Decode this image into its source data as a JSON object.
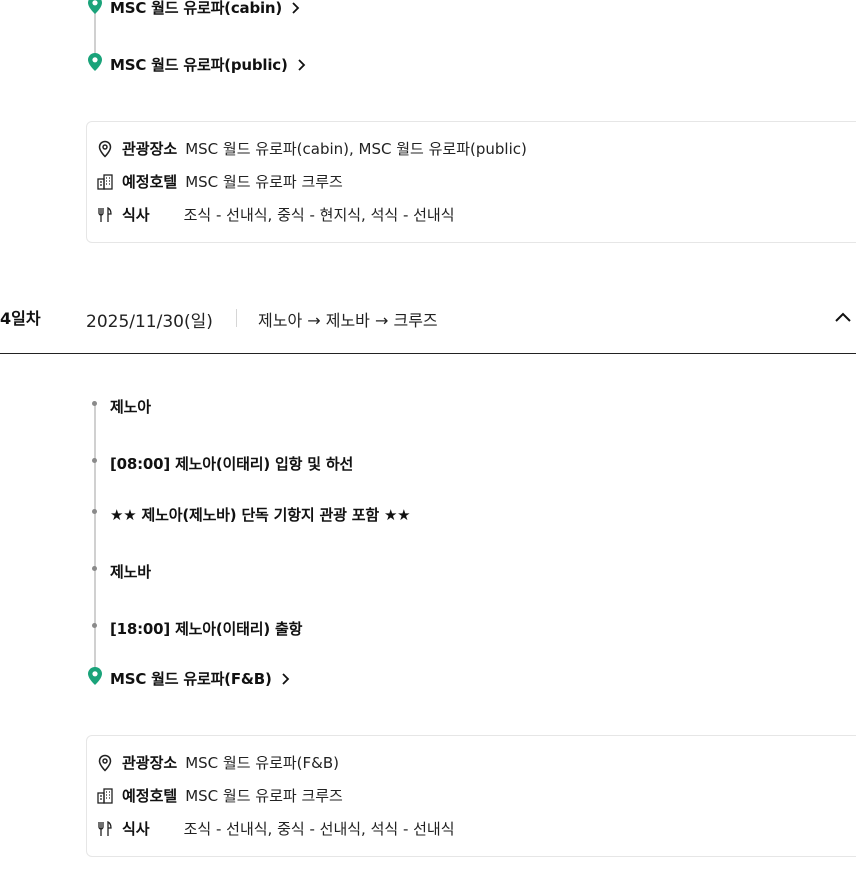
{
  "day3": {
    "items": [
      {
        "type": "pin",
        "label": "MSC 월드 유로파(cabin)"
      },
      {
        "type": "pin",
        "label": "MSC 월드 유로파(public)"
      }
    ],
    "summary": {
      "attractions_label": "관광장소",
      "attractions": "MSC 월드 유로파(cabin), MSC 월드 유로파(public)",
      "hotel_label": "예정호텔",
      "hotel": "MSC 월드 유로파 크루즈",
      "meal_label": "식사",
      "meal": "조식 - 선내식, 중식 - 현지식, 석식 - 선내식"
    }
  },
  "day4": {
    "day_label": "4일차",
    "date": "2025/11/30(일)",
    "route": "제노아 → 제노바 → 크루즈",
    "items": [
      {
        "type": "dot",
        "label": "제노아"
      },
      {
        "type": "dot",
        "label": "[08:00] 제노아(이태리) 입항 및 하선"
      },
      {
        "type": "dot",
        "label": "★★ 제노아(제노바) 단독 기항지 관광 포함 ★★"
      },
      {
        "type": "dot",
        "label": "제노바"
      },
      {
        "type": "dot",
        "label": "[18:00] 제노아(이태리) 출항"
      },
      {
        "type": "pin",
        "label": "MSC 월드 유로파(F&B)"
      }
    ],
    "summary": {
      "attractions_label": "관광장소",
      "attractions": "MSC 월드 유로파(F&B)",
      "hotel_label": "예정호텔",
      "hotel": "MSC 월드 유로파 크루즈",
      "meal_label": "식사",
      "meal": "조식 - 선내식, 중식 - 선내식, 석식 - 선내식"
    }
  },
  "colors": {
    "pin": "#1aa37a",
    "dot": "#8a8a8a",
    "timeline": "#d0d0d0",
    "border": "#e6e6e6"
  },
  "icons": {
    "pin": "map-pin-icon",
    "chevron": "chevron-right-icon",
    "location": "location-icon",
    "hotel": "building-icon",
    "meal": "fork-knife-icon",
    "collapse": "chevron-up-icon"
  }
}
